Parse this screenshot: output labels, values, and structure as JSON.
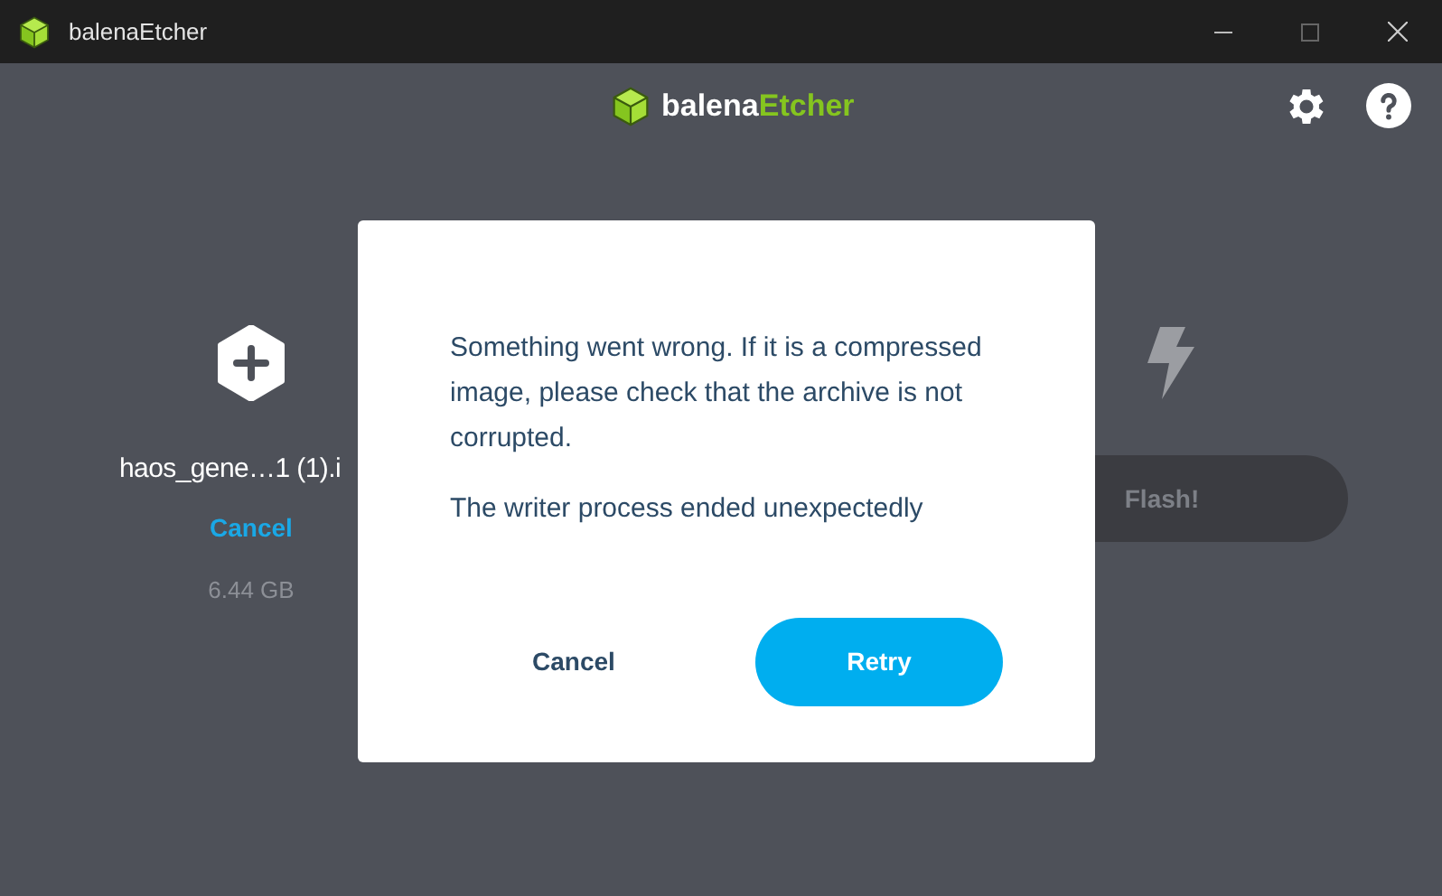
{
  "window": {
    "title": "balenaEtcher"
  },
  "header": {
    "logo_prefix": "balena",
    "logo_suffix": "Etcher"
  },
  "source": {
    "filename": "haos_gene…1 (1).i",
    "action": "Cancel",
    "size": "6.44 GB"
  },
  "flash": {
    "label": "Flash!",
    "disabled": true
  },
  "dialog": {
    "message": "Something went wrong. If it is a compressed image, please check that the archive is not corrupted.",
    "detail": "The writer process ended unexpectedly",
    "buttons": [
      {
        "label": "Cancel",
        "kind": "secondary"
      },
      {
        "label": "Retry",
        "kind": "primary"
      }
    ]
  }
}
